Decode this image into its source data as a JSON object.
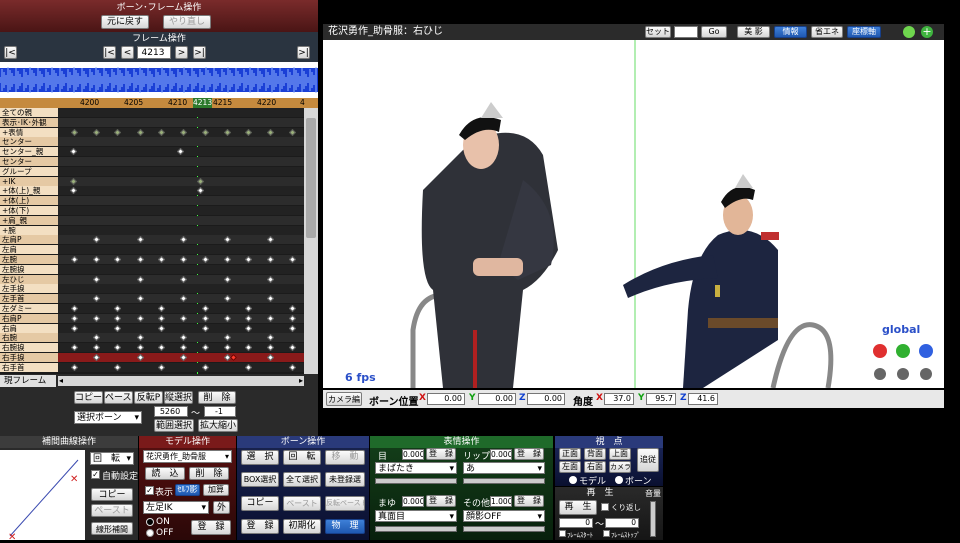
{
  "bone_frame_panel": {
    "title": "ボーン･フレーム操作",
    "undo_label": "元に戻す",
    "redo_label": "やり直し",
    "frame_ops_title": "フレーム操作",
    "first_label": "|<",
    "prev_key_label": "|<",
    "prev_label": "<",
    "current_frame": "4213",
    "next_label": ">",
    "next_key_label": ">|",
    "last_label": ">|",
    "ruler_ticks": [
      "4200",
      "4205",
      "4210",
      "4215",
      "4220",
      "4"
    ],
    "current_marker": "4213",
    "rows": [
      "全ての親",
      "表示･IK･外観",
      "+表情",
      "センター",
      "センター_親",
      "センター",
      "グループ",
      "+IK",
      "+体(上)_親",
      "+体(上)",
      "+体(下)",
      "+肩_親",
      "+腕",
      "左肩P",
      "左肩",
      "左腕",
      "左腕捩",
      "左ひじ",
      "左手捩",
      "左手首",
      "左ダミー",
      "右肩P",
      "右肩",
      "右腕",
      "右腕捩",
      "右手捩",
      "右手首"
    ],
    "current_frame_label": "現フレーム",
    "copy_label": "コピー",
    "paste_label": "ペースト",
    "reverse_paste_label": "反転P",
    "vertical_select_label": "縦選択",
    "delete_label": "削　除",
    "selection_dropdown": "選択ボーン",
    "range_from": "5260",
    "range_sep": "～",
    "range_to": "-1",
    "range_select_label": "範囲選択",
    "expand_shrink_label": "拡大縮小"
  },
  "viewport": {
    "title": "花沢勇作_助骨服：右ひじ",
    "set_label": "セット",
    "frame_value": "0",
    "go_label": "Go",
    "shadow_label": "影",
    "info_label": "情報",
    "power_save_label": "省エネ",
    "axis_label": "座標軸",
    "fps": "6 fps",
    "global_label": "global",
    "camera_edit_label": "カメラ編",
    "bone_position_label": "ボーン位置",
    "pos_x": "0.00",
    "pos_y": "0.00",
    "pos_z": "0.00",
    "angle_label": "角度",
    "angle_x": "37.0",
    "angle_y": "95.7",
    "angle_z": "41.6",
    "x_label": "X",
    "y_label": "Y",
    "z_label": "Z"
  },
  "interp_panel": {
    "title": "補間曲線操作",
    "rotate_dropdown": "回　転",
    "auto_setting_label": "自動設定",
    "copy_label": "コピー",
    "paste_label": "ペースト",
    "linear_label": "線形補間"
  },
  "model_panel": {
    "title": "モデル操作",
    "model_dropdown": "花沢勇作_助骨服",
    "load_label": "読　込",
    "delete_label": "削　除",
    "display_label": "表示",
    "shadow_label": "ｾﾙﾌ影",
    "add_label": "加算",
    "bone_dropdown": "左足IK",
    "outer_label": "外",
    "on_label": "ON",
    "off_label": "OFF",
    "register_label": "登　録"
  },
  "bone_panel": {
    "title": "ボーン操作",
    "select_label": "選　択",
    "rotate_label": "回　転",
    "move_label": "移　動",
    "box_select_label": "BOX選択",
    "select_all_label": "全て選択",
    "unregistered_label": "未登録選",
    "copy_label": "コピー",
    "paste_label": "ペースト",
    "reverse_paste_label": "反転ペースト",
    "register_label": "登　録",
    "initialize_label": "初期化",
    "physics_label": "物　理"
  },
  "morph_panel": {
    "title": "表情操作",
    "eye_label": "目",
    "eye_value": "0.000",
    "eye_register": "登　録",
    "eye_dropdown": "まばたき",
    "lip_label": "リップ",
    "lip_value": "0.000",
    "lip_register": "登　録",
    "lip_dropdown": "あ",
    "brow_label": "まゆ",
    "brow_value": "0.000",
    "brow_register": "登　録",
    "brow_dropdown": "真面目",
    "other_label": "その他",
    "other_value": "1.000",
    "other_register": "登　録",
    "other_dropdown": "顔影OFF"
  },
  "view_panel": {
    "title": "視　点",
    "front_label": "正面",
    "back_label": "背面",
    "top_label": "上面",
    "follow_label": "追従",
    "left_label": "左面",
    "right_label": "右面",
    "camera_label": "カメラ",
    "model_label": "モデル",
    "bone_label": "ボーン"
  },
  "play_panel": {
    "title": "再　生",
    "play_label": "再　生",
    "repeat_label": "くり返し",
    "volume_label": "音量",
    "from_value": "0",
    "sep": "～",
    "to_value": "0",
    "frame_start_label": "ﾌﾚｰﾑｽﾀｰﾄ",
    "frame_stop_label": "ﾌﾚｰﾑｽﾄｯﾌﾟ"
  }
}
